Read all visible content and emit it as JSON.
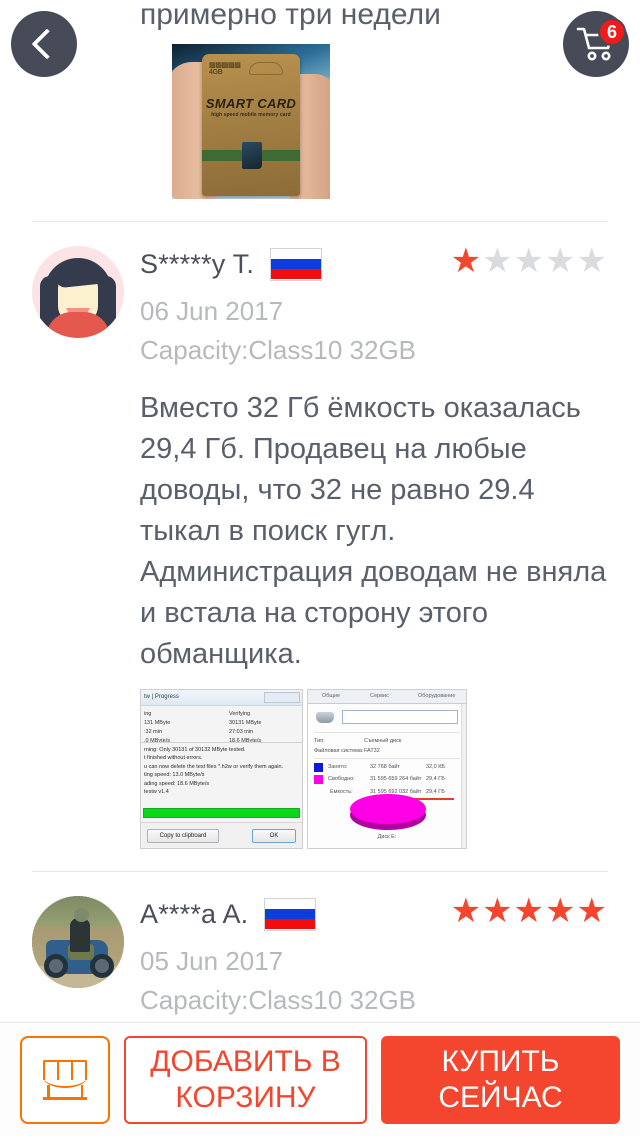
{
  "header": {
    "back_icon": "chevron-left-icon",
    "cart_icon": "shopping-cart-icon",
    "cart_badge": "6"
  },
  "partial_review": {
    "text": "примерно три недели",
    "photo_alt": "SMART CARD packaging photo",
    "photo_labels": {
      "brand": "Sinuare\n4GB",
      "title": "SMART CARD",
      "subtitle": "high speed mobile memory card"
    }
  },
  "reviews": [
    {
      "avatar_type": "illustrated-female-avatar",
      "name": "S*****y T.",
      "country_flag": "russia-flag",
      "rating": 1,
      "rating_max": 5,
      "date": "06 Jun 2017",
      "spec": "Capacity:Class10 32GB",
      "body": "Вместо 32 Гб ёмкость оказалась 29,4 Гб. Продавец  на любые доводы, что 32 не равно 29.4 тыкал в поиск гугл. Администрация доводам не вняла и встала на сторону этого обманщика.",
      "photos": [
        {
          "kind": "h2testw-screenshot",
          "window_title": "tw | Progress",
          "col_left": [
            "ing",
            "131 MByte",
            ":32 min",
            ".0 MByte/s"
          ],
          "col_right": [
            "Verifying",
            "30131 MByte",
            "27:03 min",
            "18.6 MByte/s"
          ],
          "log": [
            "rning: Only 30131 of 30132 MByte tested.",
            "t finished without errors.",
            "u can now delete the test files *.h2w or verify them again.",
            "ting speed: 13.0 MByte/s",
            "ading speed: 18.6 MByte/s",
            "testw v1.4"
          ],
          "copy_button": "Copy to clipboard",
          "ok_button": "OK",
          "progress_color": "#0ad81b"
        },
        {
          "kind": "disk-properties-screenshot",
          "tabs": [
            "Общие",
            "Сервис",
            "Оборудование"
          ],
          "type_label": "Тип:",
          "type_value": "Съемный диск",
          "fs_label": "Файловая система:",
          "fs_value": "FAT32",
          "used_label": "Занято:",
          "used_bytes": "32 768 байт",
          "used_size": "32,0 КБ",
          "free_label": "Свободно:",
          "free_bytes": "31 595 659 264 байт",
          "free_size": "29,4 ГБ",
          "capacity_label": "Емкость:",
          "capacity_bytes": "31 595 692 032 байт",
          "capacity_size": "29,4 ГБ",
          "pie_label": "Диск E:",
          "pie_color": "#ff00e6"
        }
      ]
    },
    {
      "avatar_type": "motorcycle-photo-avatar",
      "name": "A****a A.",
      "country_flag": "russia-flag",
      "rating": 5,
      "rating_max": 5,
      "date": "05 Jun 2017",
      "spec": "Capacity:Class10 32GB",
      "body": "",
      "photos": []
    }
  ],
  "bottom_bar": {
    "store_icon": "storefront-icon",
    "add_to_cart_label": "ДОБАВИТЬ В КОРЗИНУ",
    "buy_now_label": "КУПИТЬ СЕЙЧАС"
  },
  "colors": {
    "accent_red": "#f4452e",
    "accent_orange": "#f97300",
    "fab_dark": "#474b57",
    "muted_text": "#b6b9bd",
    "body_text": "#5a606b"
  }
}
